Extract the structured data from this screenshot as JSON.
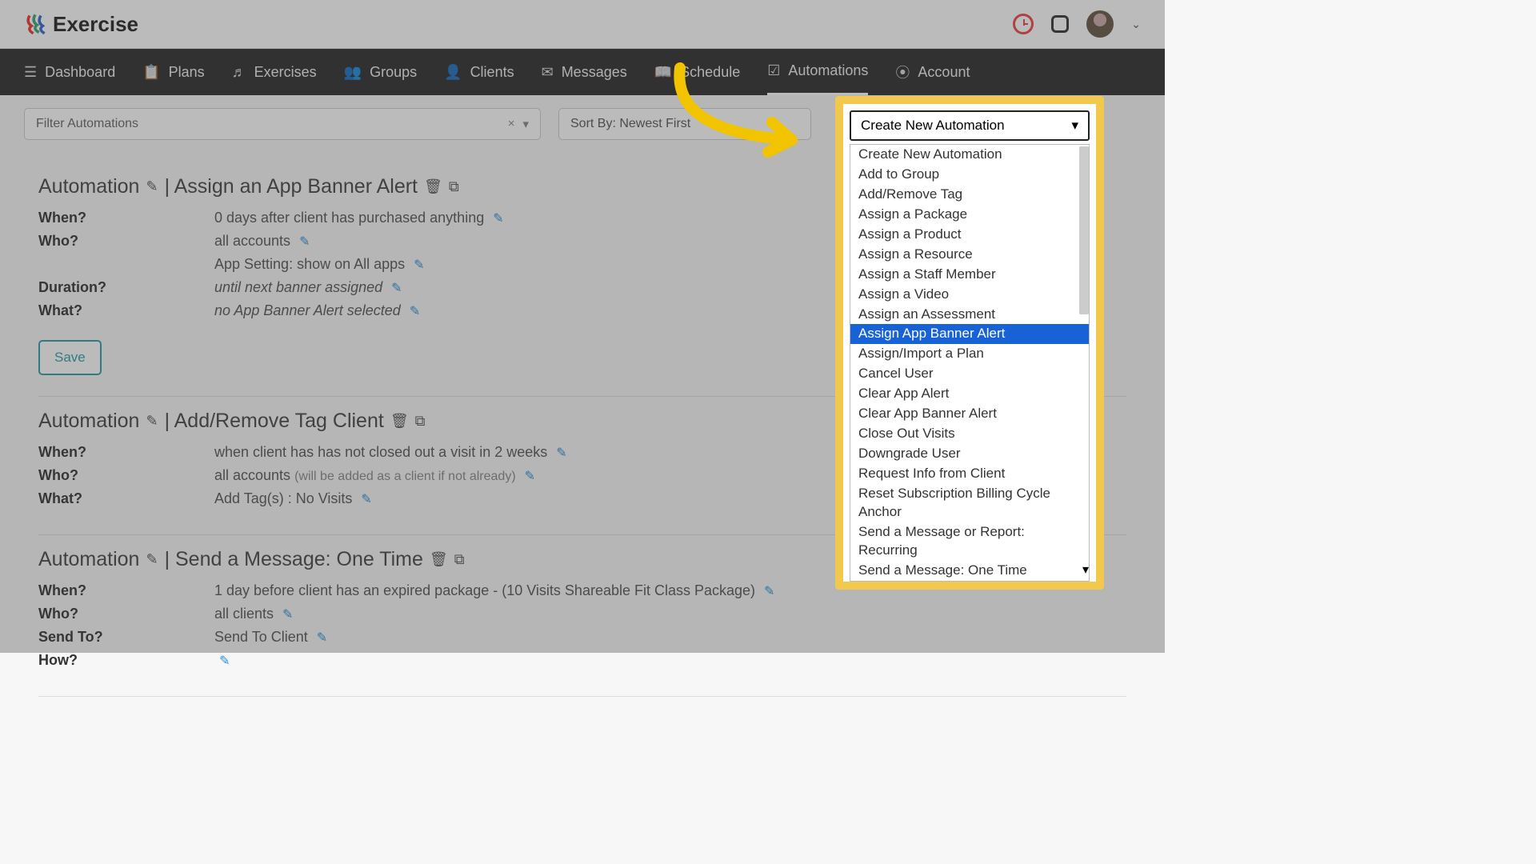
{
  "brand": "Exercise",
  "nav": {
    "items": [
      {
        "icon": "☰",
        "label": "Dashboard"
      },
      {
        "icon": "📋",
        "label": "Plans"
      },
      {
        "icon": "♬",
        "label": "Exercises"
      },
      {
        "icon": "👥",
        "label": "Groups"
      },
      {
        "icon": "👤",
        "label": "Clients"
      },
      {
        "icon": "✉",
        "label": "Messages"
      },
      {
        "icon": "📖",
        "label": "Schedule"
      },
      {
        "icon": "☑",
        "label": "Automations",
        "active": true
      },
      {
        "icon": "⦿",
        "label": "Account"
      }
    ]
  },
  "filter": {
    "placeholder": "Filter Automations",
    "clear": "×",
    "caret": "▾"
  },
  "sort": {
    "label": "Sort By: Newest First"
  },
  "create": {
    "button": "Create New Automation",
    "caret": "▾",
    "options": [
      "Create New Automation",
      "Add to Group",
      "Add/Remove Tag",
      "Assign a Package",
      "Assign a Product",
      "Assign a Resource",
      "Assign a Staff Member",
      "Assign a Video",
      "Assign an Assessment",
      "Assign App Banner Alert",
      "Assign/Import a Plan",
      "Cancel User",
      "Clear App Alert",
      "Clear App Banner Alert",
      "Close Out Visits",
      "Downgrade User",
      "Request Info from Client",
      "Reset Subscription Billing Cycle Anchor",
      "Send a Message or Report: Recurring",
      "Send a Message: One Time"
    ],
    "selected_index": 9
  },
  "automations": [
    {
      "title_prefix": "Automation",
      "title_action": "Assign an App Banner Alert",
      "fields": {
        "when_label": "When?",
        "when_value": "0 days after client has purchased anything",
        "who_label": "Who?",
        "who_value": "all accounts",
        "setting": "App Setting: show on All apps",
        "duration_label": "Duration?",
        "duration_value": "until next banner assigned",
        "what_label": "What?",
        "what_value": "no App Banner Alert selected"
      },
      "save": "Save"
    },
    {
      "title_prefix": "Automation",
      "title_action": "Add/Remove Tag Client",
      "fields": {
        "when_label": "When?",
        "when_value": "when client has has not closed out a visit in 2 weeks",
        "who_label": "Who?",
        "who_value": "all accounts",
        "who_hint": "(will be added as a client if not already)",
        "what_label": "What?",
        "what_value": "Add Tag(s) : No Visits"
      }
    },
    {
      "title_prefix": "Automation",
      "title_action": "Send a Message: One Time",
      "fields": {
        "when_label": "When?",
        "when_value": "1 day before client has an expired package - (10 Visits Shareable Fit Class Package)",
        "who_label": "Who?",
        "who_value": "all clients",
        "sendto_label": "Send To?",
        "sendto_value": "Send To Client",
        "how_label": "How?",
        "how_value": ""
      }
    }
  ]
}
